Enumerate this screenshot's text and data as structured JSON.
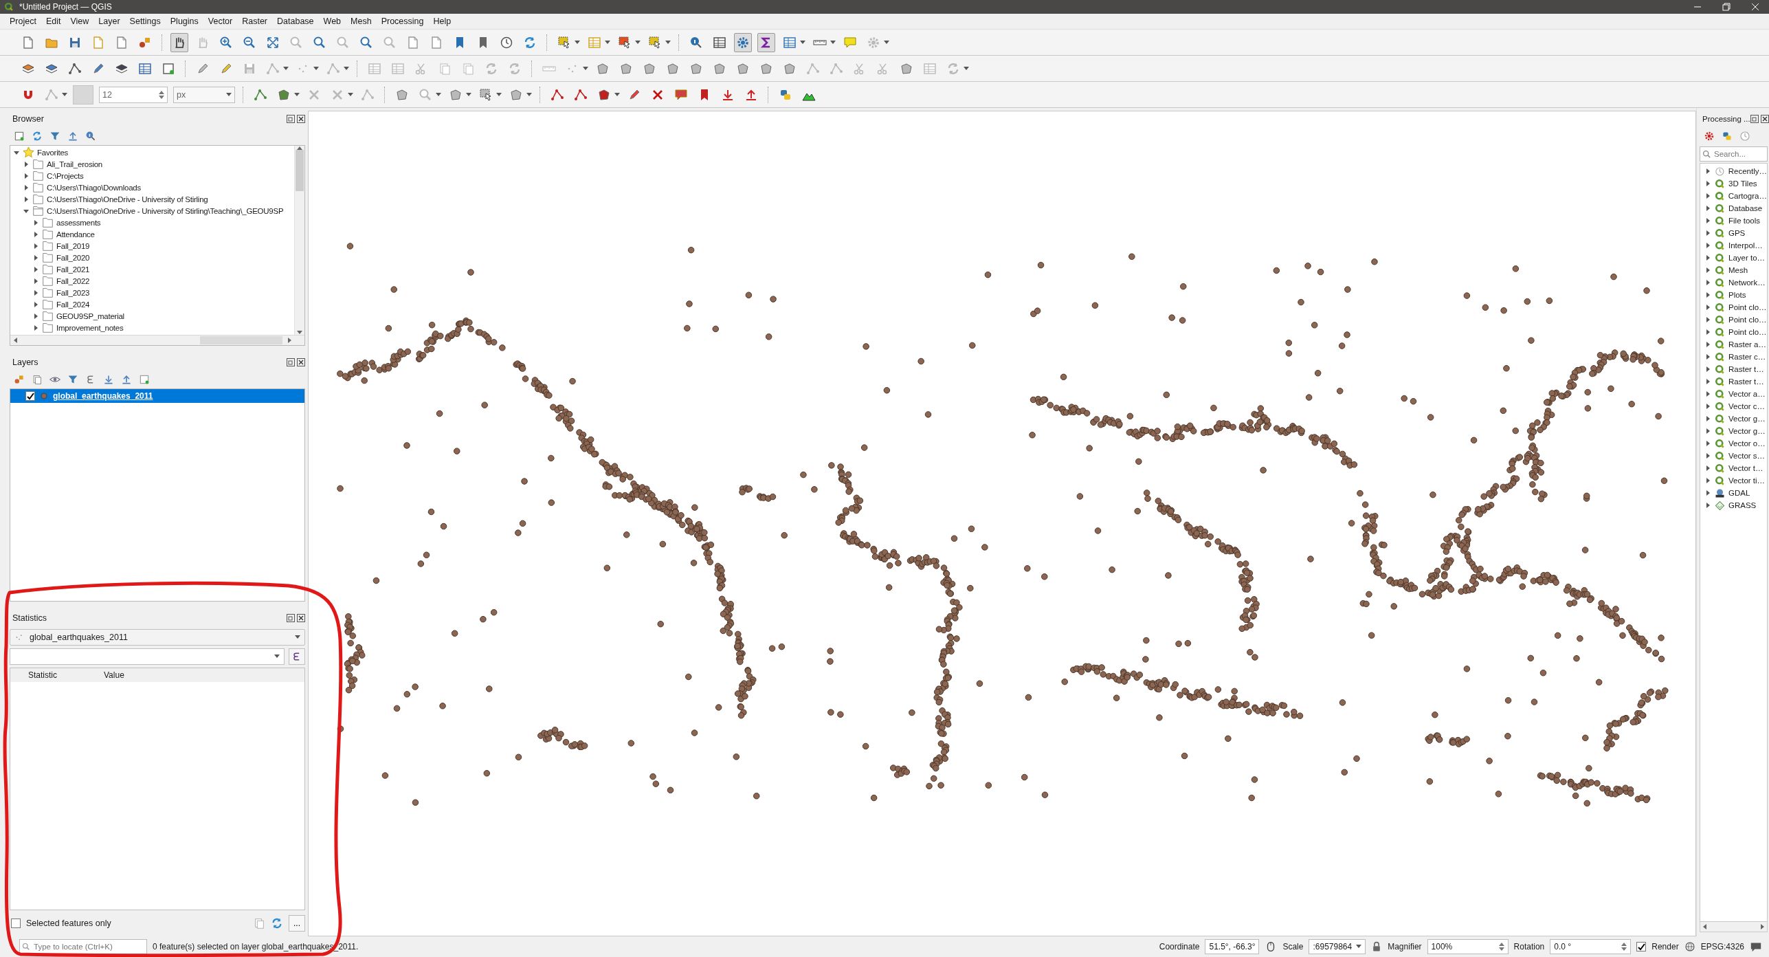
{
  "window": {
    "title": "*Untitled Project — QGIS"
  },
  "menu_bar": [
    "Project",
    "Edit",
    "View",
    "Layer",
    "Settings",
    "Plugins",
    "Vector",
    "Raster",
    "Database",
    "Web",
    "Mesh",
    "Processing",
    "Help"
  ],
  "snapping_toolbar": {
    "tolerance": "12",
    "units": "px"
  },
  "browser_panel": {
    "title": "Browser",
    "tree": [
      {
        "label": "Favorites",
        "kind": "favorites",
        "expanded": true,
        "children": [
          {
            "label": "Ali_Trail_erosion",
            "kind": "folder",
            "expanded": false
          },
          {
            "label": "C:\\Projects",
            "kind": "folder",
            "expanded": false
          },
          {
            "label": "C:\\Users\\Thiago\\Downloads",
            "kind": "folder",
            "expanded": false
          },
          {
            "label": "C:\\Users\\Thiago\\OneDrive - University of Stirling",
            "kind": "folder",
            "expanded": false
          },
          {
            "label": "C:\\Users\\Thiago\\OneDrive - University of Stirling\\Teaching\\_GEOU9SP",
            "kind": "folder",
            "expanded": true,
            "children": [
              {
                "label": "assessments",
                "kind": "folder",
                "expanded": false
              },
              {
                "label": "Attendance",
                "kind": "folder",
                "expanded": false
              },
              {
                "label": "Fall_2019",
                "kind": "folder",
                "expanded": false
              },
              {
                "label": "Fall_2020",
                "kind": "folder",
                "expanded": false
              },
              {
                "label": "Fall_2021",
                "kind": "folder",
                "expanded": false
              },
              {
                "label": "Fall_2022",
                "kind": "folder",
                "expanded": false
              },
              {
                "label": "Fall_2023",
                "kind": "folder",
                "expanded": false
              },
              {
                "label": "Fall_2024",
                "kind": "folder",
                "expanded": false
              },
              {
                "label": "GEOU9SP_material",
                "kind": "folder",
                "expanded": false
              },
              {
                "label": "Improvement_notes",
                "kind": "folder",
                "expanded": false
              }
            ]
          }
        ]
      }
    ]
  },
  "layers_panel": {
    "title": "Layers",
    "layers": [
      {
        "name": "global_earthquakes_2011",
        "checked": true,
        "selected": true
      }
    ]
  },
  "statistics_panel": {
    "title": "Statistics",
    "layer": "global_earthquakes_2011",
    "columns": [
      "Statistic",
      "Value"
    ],
    "selected_only": {
      "label": "Selected features only",
      "checked": false
    },
    "more_button": "..."
  },
  "processing_panel": {
    "title": "Processing ...",
    "search_placeholder": "Search...",
    "items": [
      {
        "label": "Recently…",
        "kind": "recent"
      },
      {
        "label": "3D Tiles",
        "kind": "qgis"
      },
      {
        "label": "Cartogra…",
        "kind": "qgis"
      },
      {
        "label": "Database",
        "kind": "qgis"
      },
      {
        "label": "File tools",
        "kind": "qgis"
      },
      {
        "label": "GPS",
        "kind": "qgis"
      },
      {
        "label": "Interpol…",
        "kind": "qgis"
      },
      {
        "label": "Layer to…",
        "kind": "qgis"
      },
      {
        "label": "Mesh",
        "kind": "qgis"
      },
      {
        "label": "Network…",
        "kind": "qgis"
      },
      {
        "label": "Plots",
        "kind": "qgis"
      },
      {
        "label": "Point clo…",
        "kind": "qgis"
      },
      {
        "label": "Point clo…",
        "kind": "qgis"
      },
      {
        "label": "Point clo…",
        "kind": "qgis"
      },
      {
        "label": "Raster a…",
        "kind": "qgis"
      },
      {
        "label": "Raster c…",
        "kind": "qgis"
      },
      {
        "label": "Raster t…",
        "kind": "qgis"
      },
      {
        "label": "Raster t…",
        "kind": "qgis"
      },
      {
        "label": "Vector a…",
        "kind": "qgis"
      },
      {
        "label": "Vector c…",
        "kind": "qgis"
      },
      {
        "label": "Vector g…",
        "kind": "qgis"
      },
      {
        "label": "Vector g…",
        "kind": "qgis"
      },
      {
        "label": "Vector o…",
        "kind": "qgis"
      },
      {
        "label": "Vector s…",
        "kind": "qgis"
      },
      {
        "label": "Vector t…",
        "kind": "qgis"
      },
      {
        "label": "Vector ti…",
        "kind": "qgis"
      },
      {
        "label": "GDAL",
        "kind": "gdal"
      },
      {
        "label": "GRASS",
        "kind": "grass"
      }
    ]
  },
  "status_bar": {
    "locator_placeholder": "Type to locate (Ctrl+K)",
    "message": "0 feature(s) selected on layer global_earthquakes_2011.",
    "coordinate_label": "Coordinate",
    "coordinate": "51.5°, -66.3°",
    "scale_label": "Scale",
    "scale": ":69579864",
    "magnifier_label": "Magnifier",
    "magnifier": "100%",
    "rotation_label": "Rotation",
    "rotation": "0.0 °",
    "render": {
      "label": "Render",
      "checked": true
    },
    "crs": "EPSG:4326"
  }
}
